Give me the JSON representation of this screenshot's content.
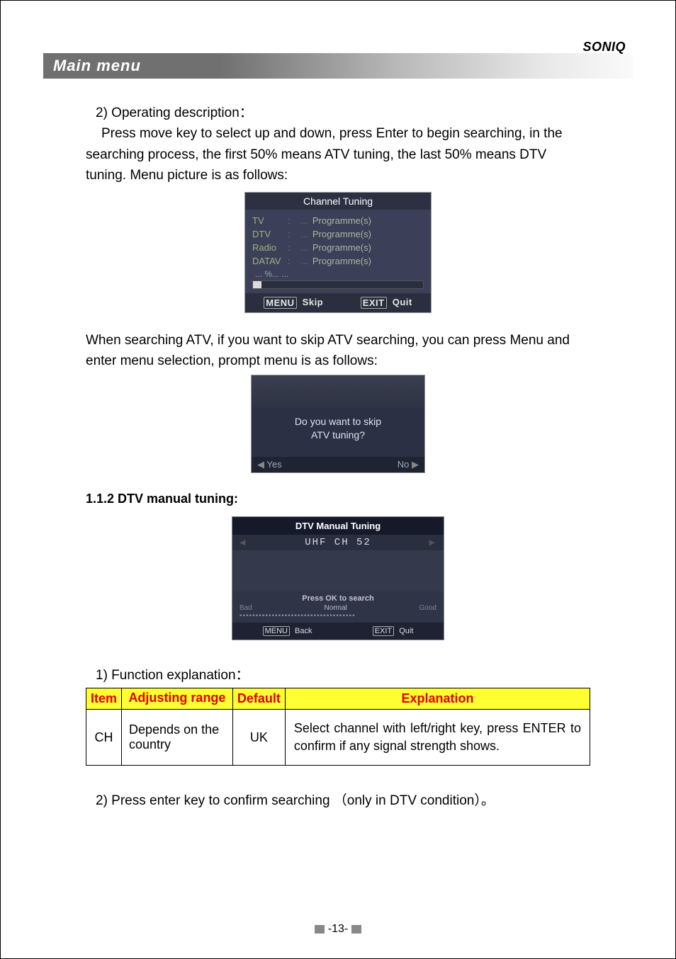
{
  "brand": "SONIQ",
  "titleBar": "Main menu",
  "section2_heading": "2) Operating description：",
  "section2_para": "Press move key to select up and down, press Enter to begin searching, in the searching process, the first 50% means ATV tuning, the last 50% means DTV tuning. Menu picture is as follows:",
  "channelTuning": {
    "title": "Channel Tuning",
    "rows": [
      {
        "label": "TV",
        "value": "Programme(s)"
      },
      {
        "label": "DTV",
        "value": "Programme(s)"
      },
      {
        "label": "Radio",
        "value": "Programme(s)"
      },
      {
        "label": "DATAV",
        "value": "Programme(s)"
      }
    ],
    "progress": "... %... ...",
    "menuKey": "MENU",
    "skip": "Skip",
    "exitKey": "EXIT",
    "quit": "Quit"
  },
  "atv_skip_para": "When searching ATV, if you want to skip ATV searching, you can press Menu and enter menu selection, prompt menu is as follows:",
  "skipDialog": {
    "line1": "Do you want to skip",
    "line2": "ATV tuning?",
    "yes": "Yes",
    "no": "No"
  },
  "subheading": "1.1.2 DTV manual tuning:",
  "dtv": {
    "title": "DTV Manual Tuning",
    "channel": "UHF  CH  52",
    "press": "Press OK to search",
    "bad": "Bad",
    "normal": "Normal",
    "good": "Good",
    "backKey": "MENU",
    "back": "Back",
    "quitKey": "EXIT",
    "quit": "Quit"
  },
  "funcExpl": "1) Function explanation：",
  "table": {
    "headers": {
      "item": "Item",
      "range": "Adjusting range",
      "def": "Default",
      "expl": "Explanation"
    },
    "row1": {
      "item": "CH",
      "range": "Depends on the country",
      "def": "UK",
      "expl": "Select channel with left/right key, press ENTER to confirm if any signal strength shows."
    }
  },
  "lastPara": "2) Press enter key to confirm searching （only in DTV condition）。",
  "pageNum": "-13-"
}
